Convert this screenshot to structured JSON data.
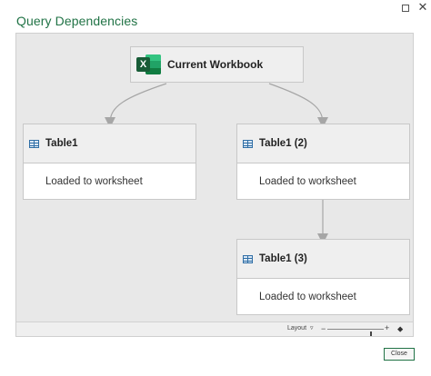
{
  "window": {
    "title": "Query Dependencies",
    "maximize_icon": "maximize-icon",
    "close_glyph": "✕"
  },
  "diagram": {
    "root": {
      "label": "Current Workbook",
      "icon": "excel-icon",
      "icon_letter": "X"
    },
    "nodes": [
      {
        "title": "Table1",
        "status": "Loaded to worksheet",
        "icon": "table-icon"
      },
      {
        "title": "Table1 (2)",
        "status": "Loaded to worksheet",
        "icon": "table-icon"
      },
      {
        "title": "Table1 (3)",
        "status": "Loaded to worksheet",
        "icon": "table-icon"
      }
    ],
    "connector_color": "#a6a6a6"
  },
  "statusbar": {
    "layout_label": "Layout",
    "layout_dropdown_glyph": "▿",
    "zoom_minus": "−",
    "zoom_plus": "+",
    "zoom_level": 0.78,
    "fit_icon_glyph": "⬥"
  },
  "footer": {
    "close_label": "Close"
  },
  "colors": {
    "accent": "#217346",
    "canvas_bg": "#e8e8e8",
    "node_header_bg": "#efefef"
  }
}
